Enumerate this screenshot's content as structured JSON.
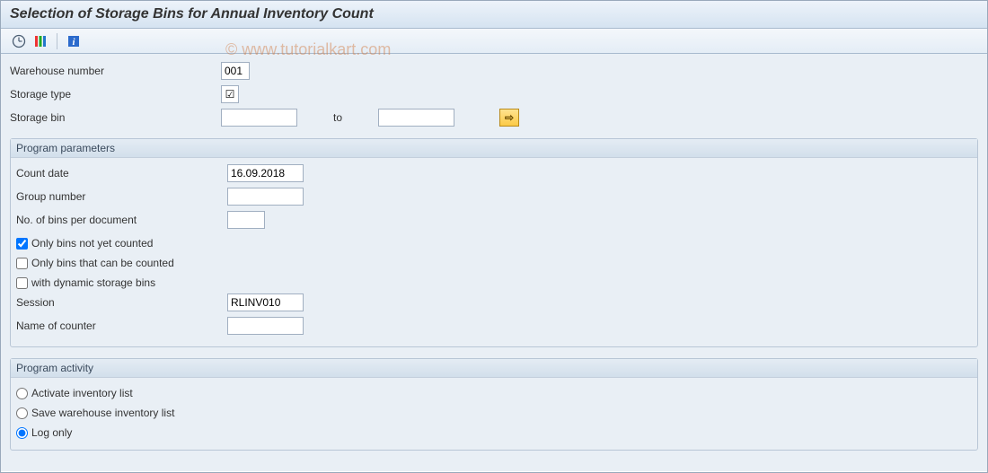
{
  "header": {
    "title": "Selection of Storage Bins for Annual Inventory Count"
  },
  "watermark": "© www.tutorialkart.com",
  "selection": {
    "warehouse_label": "Warehouse number",
    "warehouse_value": "001",
    "storage_type_label": "Storage type",
    "storage_type_checked": "☑",
    "storage_bin_label": "Storage bin",
    "storage_bin_from": "",
    "to_label": "to",
    "storage_bin_to": ""
  },
  "program_parameters": {
    "groupbox_title": "Program parameters",
    "count_date_label": "Count date",
    "count_date_value": "16.09.2018",
    "group_number_label": "Group number",
    "group_number_value": "",
    "bins_per_doc_label": "No. of bins per document",
    "bins_per_doc_value": "",
    "cb_not_counted_label": "Only bins not yet counted",
    "cb_not_counted_checked": true,
    "cb_can_be_counted_label": "Only bins that can be counted",
    "cb_can_be_counted_checked": false,
    "cb_dynamic_label": "with dynamic storage bins",
    "cb_dynamic_checked": false,
    "session_label": "Session",
    "session_value": "RLINV010",
    "name_of_counter_label": "Name of counter",
    "name_of_counter_value": ""
  },
  "program_activity": {
    "groupbox_title": "Program activity",
    "rb_activate_label": "Activate inventory list",
    "rb_save_label": "Save warehouse inventory list",
    "rb_log_label": "Log only",
    "selected": "log"
  },
  "multi_arrow_glyph": "⇨"
}
